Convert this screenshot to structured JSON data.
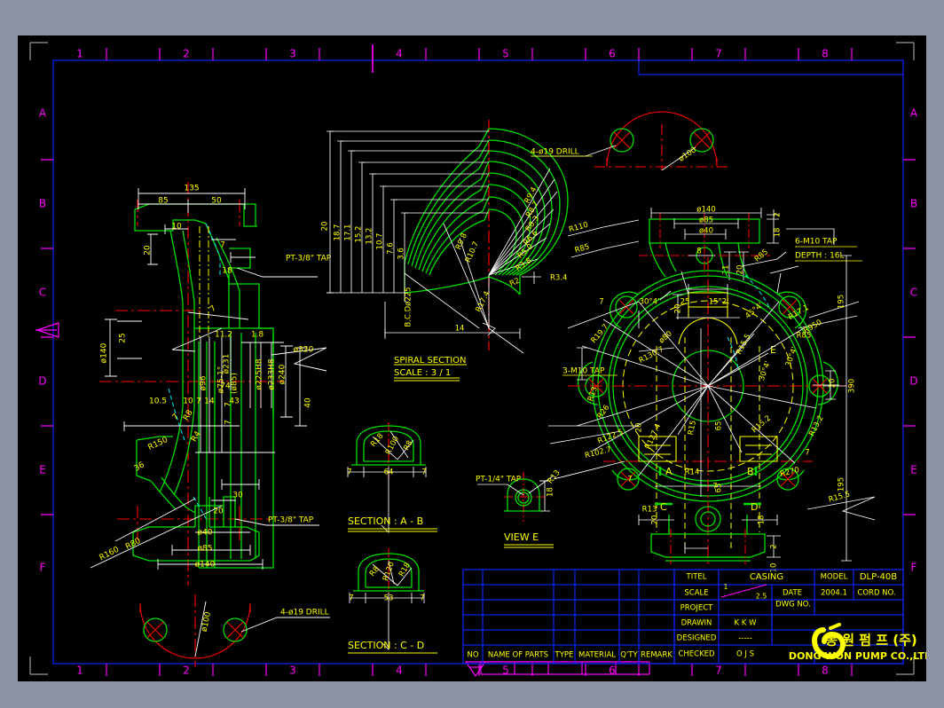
{
  "document": {
    "background": "#8a94a6",
    "sheet_color": "#000000",
    "frame_color": "#0000ff",
    "grid_label_color": "#ff00ff",
    "dimension_color": "#ffff00",
    "leader_color": "#ffffff",
    "geometry_color": "#00ff00",
    "centerline_color": "#ff0000",
    "hidden_color": "#00ffff"
  },
  "frame": {
    "top_grid": [
      "1",
      "2",
      "3",
      "4",
      "5",
      "6",
      "7",
      "8"
    ],
    "bottom_grid": [
      "1",
      "2",
      "3",
      "4",
      "5",
      "6",
      "7",
      "8"
    ],
    "left_letters": [
      "A",
      "B",
      "C",
      "D",
      "E",
      "F"
    ],
    "right_letters": [
      "A",
      "B",
      "C",
      "D",
      "E",
      "F"
    ]
  },
  "title_block": {
    "rows": [
      {
        "label": "TITEL",
        "value": "CASING",
        "label2": "MODEL",
        "value2": "DLP-40B"
      },
      {
        "label": "SCALE",
        "value": "1 / 2.5",
        "label2": "DATE",
        "value2": "2004.1",
        "label3": "CORD NO.",
        "value3": ""
      },
      {
        "label": "PROJECT",
        "value": "",
        "label2": "DWG NO.",
        "value2": ""
      },
      {
        "label": "DRAWIN",
        "value": "K K W"
      },
      {
        "label": "DESIGNED",
        "value": "-----"
      },
      {
        "label": "CHECKED",
        "value": "O J S"
      }
    ],
    "scale_num": "1",
    "scale_den": "2.5",
    "company_kr": "동 원 펌 프 (주)",
    "company_en": "DONG WON PUMP CO.,LTD"
  },
  "parts_table": {
    "headers": [
      "NO",
      "NAME OF PARTS",
      "TYPE",
      "MATERIAL",
      "Q'TY",
      "REMARK"
    ],
    "empty_rows": 4
  },
  "views": {
    "section_view": {
      "left_dims_top": [
        "135",
        "85",
        "50"
      ],
      "inner_top": [
        "10",
        "7",
        "20",
        "18"
      ],
      "left_vert": [
        "ø140",
        "25"
      ],
      "mid_dims": [
        "ø231",
        "11.2",
        "1.8",
        "7",
        "ø96",
        "ø75-1°",
        "(ø85)",
        "ø225H8",
        "ø233H8",
        "ø240",
        "ø320",
        "40"
      ],
      "lower_dims": [
        "10.5",
        "10",
        "7",
        "14",
        "43",
        "74",
        "7",
        "30",
        "36",
        "R8",
        "R4",
        "R160",
        "R80",
        "R150"
      ],
      "bottom_dims": [
        "ø40",
        "ø85",
        "ø140",
        "20"
      ],
      "taps": [
        "PT-3/8\" TAP",
        "PT-3/8\" TAP"
      ],
      "drill_note": "4-ø19 DRILL",
      "bolt_circle": "ø100"
    },
    "spiral_section": {
      "title": "SPIRAL SECTION",
      "scale": "SCALE : 3 / 1",
      "ladder_dims": [
        "20",
        "18.7",
        "17.1",
        "15.2",
        "13.2",
        "10.7",
        "7.6",
        "3.6"
      ],
      "bc_note": "B.C.Dø225",
      "radii": [
        "R9.4",
        "R8.7",
        "R8.3",
        "R6.6",
        "R5.0",
        "R3.8",
        "R2",
        "R3.4",
        "R9.8",
        "R10.7",
        "R17.4"
      ],
      "width": "14"
    },
    "front_view": {
      "top_notes": [
        "4-ø19 DRILL",
        "ø100",
        "6-M10 TAP",
        "DEPTH : 16L",
        "3-M10 TAP"
      ],
      "top_dims": [
        "ø140",
        "ø85",
        "ø40",
        "8",
        "11",
        "20",
        "2",
        "18"
      ],
      "radii": [
        "R110",
        "R85",
        "R20",
        "R14",
        "R12",
        "R7.6",
        "R85",
        "R13",
        "R26",
        "R13",
        "R19.7",
        "R130.7",
        "R15",
        "R127.4",
        "R17.1",
        "R950",
        "R122.5",
        "R102.7",
        "R15.2",
        "R13.2",
        "R14",
        "R270",
        "R15.5",
        "R13"
      ],
      "angles": [
        "30°4'",
        "15°2'",
        "45°4'",
        "30°4'",
        "30°4'",
        "45°4'"
      ],
      "dims": [
        "25",
        "20",
        "ø80",
        "65",
        "65",
        "7",
        "7",
        "12",
        "26",
        "20",
        "20",
        "18",
        "2",
        "10",
        "195",
        "390",
        "195",
        "20"
      ],
      "section_marks": [
        "A",
        "B",
        "C",
        "D",
        "E"
      ]
    },
    "section_ab": {
      "title": "SECTION : A - B",
      "radii": [
        "R18",
        "R100",
        "R8"
      ],
      "dims": [
        "7",
        "64",
        "7"
      ]
    },
    "section_cd": {
      "title": "SECTION : C - D",
      "radii": [
        "R8",
        "R120",
        "R18"
      ],
      "dims": [
        "7",
        "53",
        "7"
      ]
    },
    "view_e": {
      "title": "VIEW E",
      "tap": "PT-1/4\" TAP",
      "radius": "R13",
      "dim": "18"
    }
  }
}
